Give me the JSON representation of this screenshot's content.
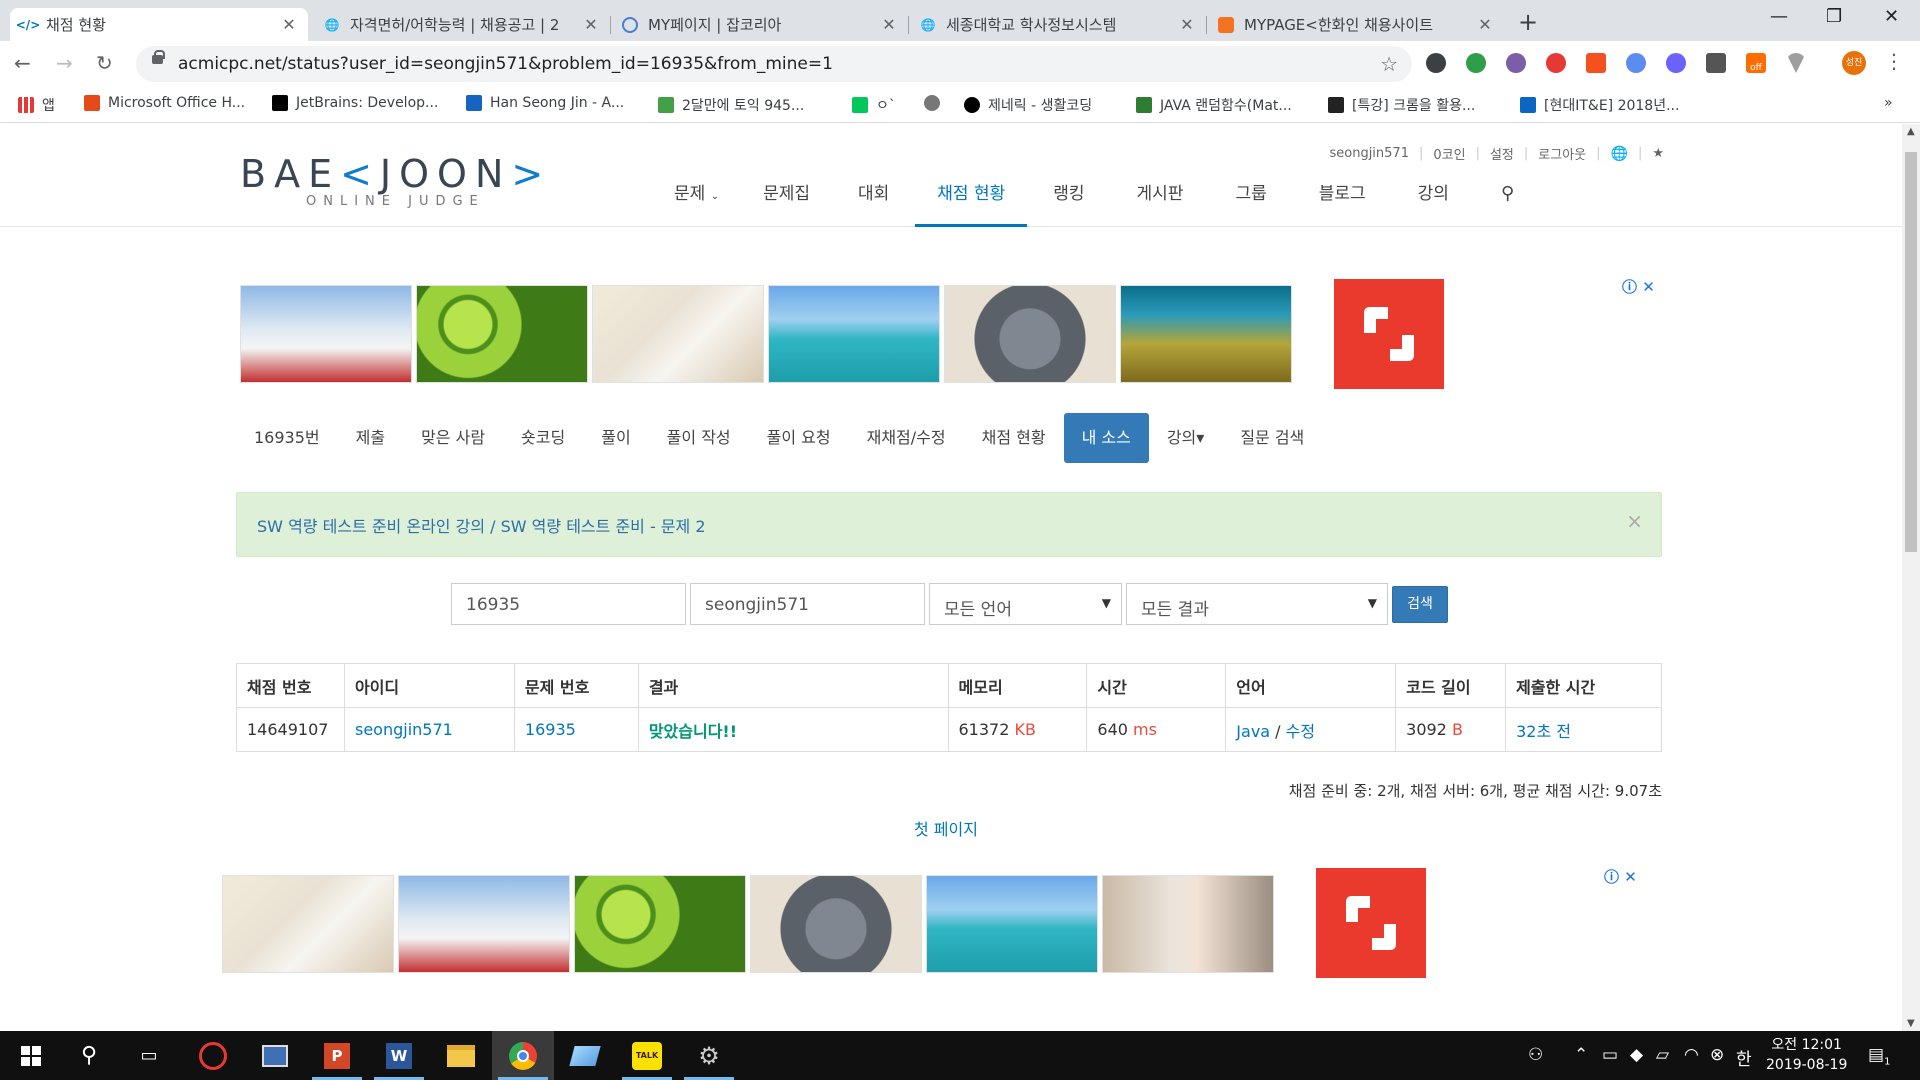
{
  "browser": {
    "tabs": [
      {
        "title": "채점 현황",
        "active": true
      },
      {
        "title": "자격면허/어학능력 | 채용공고 | 2",
        "active": false
      },
      {
        "title": "MY페이지 | 잡코리아",
        "active": false
      },
      {
        "title": "세종대학교 학사정보시스템",
        "active": false
      },
      {
        "title": "MYPAGE<한화인 채용사이트",
        "active": false
      }
    ],
    "url": "acmicpc.net/status?user_id=seongjin571&problem_id=16935&from_mine=1",
    "bookmarks": [
      "앱",
      "Microsoft Office H...",
      "JetBrains: Develop...",
      "Han Seong Jin - A...",
      "2달만에 토익 945...",
      "ㅇ`",
      "",
      "제네릭 - 생활코딩",
      "JAVA 랜덤함수(Mat...",
      "[특강] 크롬을 활용...",
      "[현대IT&E] 2018년..."
    ],
    "ext_labels": {
      "off": "off",
      "profile": "성진"
    },
    "colors": {
      "tabbar": "#dee1e6",
      "accent": "#0076c0"
    }
  },
  "site": {
    "logo": {
      "main": "BAEKJOON",
      "sub": "ONLINE JUDGE"
    },
    "top_menu": [
      "seongjin571",
      "0코인",
      "설정",
      "로그아웃"
    ],
    "main_menu": [
      "문제",
      "문제집",
      "대회",
      "채점 현황",
      "랭킹",
      "게시판",
      "그룹",
      "블로그",
      "강의"
    ],
    "active_menu": "채점 현황"
  },
  "problem_nav": {
    "items": [
      "16935번",
      "제출",
      "맞은 사람",
      "숏코딩",
      "풀이",
      "풀이 작성",
      "풀이 요청",
      "재채점/수정",
      "채점 현황",
      "내 소스",
      "강의▾",
      "질문 검색"
    ],
    "active": "내 소스"
  },
  "alert": {
    "link1": "SW 역량 테스트 준비 온라인 강의",
    "sep": " / ",
    "link2": "SW 역량 테스트 준비 - 문제 2",
    "close": "×"
  },
  "search": {
    "problem_id": "16935",
    "user_id": "seongjin571",
    "language": "모든 언어",
    "result": "모든 결과",
    "button": "검색"
  },
  "table": {
    "headers": [
      "채점 번호",
      "아이디",
      "문제 번호",
      "결과",
      "메모리",
      "시간",
      "언어",
      "코드 길이",
      "제출한 시간"
    ],
    "rows": [
      {
        "submission": "14649107",
        "user": "seongjin571",
        "problem": "16935",
        "result": "맞았습니다!!",
        "memory": "61372",
        "memory_unit": " KB",
        "time": "640",
        "time_unit": " ms",
        "language": "Java",
        "lang_sep": " / ",
        "edit": "수정",
        "code_length": "3092",
        "code_unit": " B",
        "submitted": "32초 전"
      }
    ]
  },
  "stats": "채점 준비 중: 2개, 채점 서버: 6개, 평균 채점 시간: 9.07초",
  "pagination": {
    "first": "첫 페이지"
  },
  "ads": {
    "info": "ⓘ",
    "close": "✕"
  },
  "taskbar": {
    "time": "오전 12:01",
    "date": "2019-08-19",
    "ime": "한",
    "notifications": "1",
    "kakao": "TALK"
  }
}
